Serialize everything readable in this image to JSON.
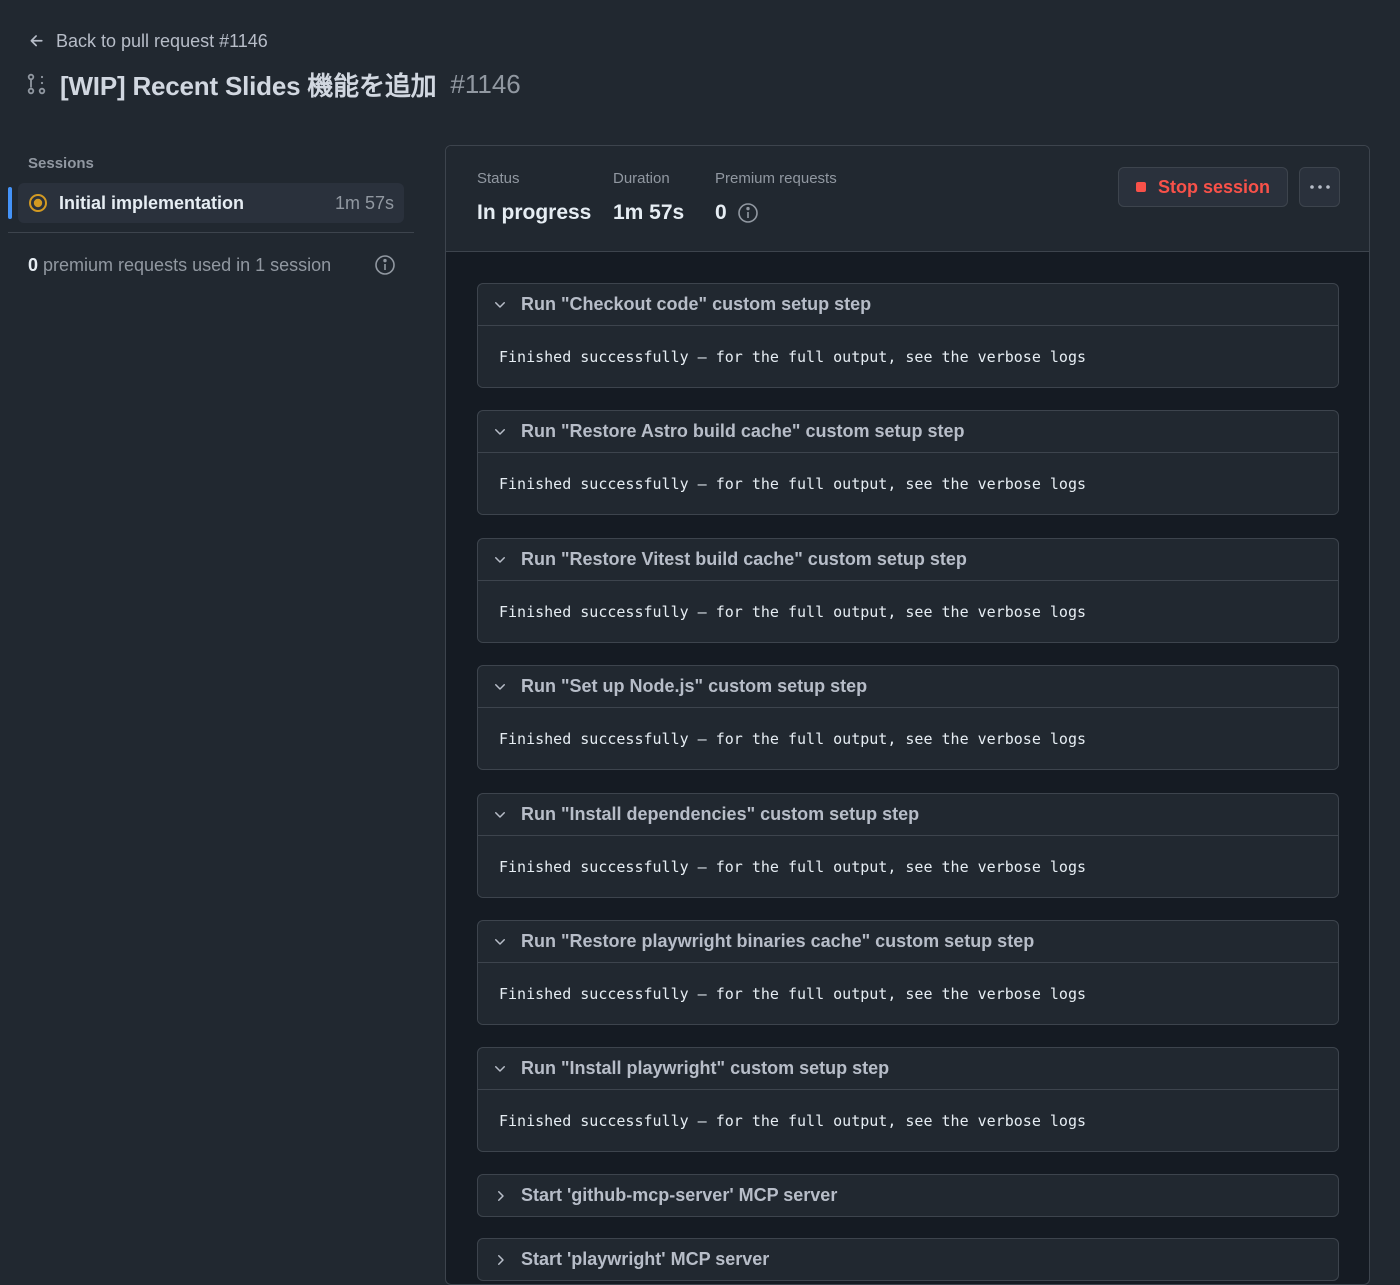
{
  "header": {
    "back_label": "Back to pull request #1146",
    "title": "[WIP] Recent Slides 機能を追加",
    "pr_number": "#1146"
  },
  "sidebar": {
    "heading": "Sessions",
    "sessions": [
      {
        "name": "Initial implementation",
        "duration": "1m 57s",
        "status": "in-progress"
      }
    ],
    "usage": {
      "count": "0",
      "text": "premium requests used in 1 session"
    }
  },
  "summary": {
    "status_label": "Status",
    "status_value": "In progress",
    "duration_label": "Duration",
    "duration_value": "1m 57s",
    "premium_label": "Premium requests",
    "premium_value": "0",
    "stop_label": "Stop session"
  },
  "steps": [
    {
      "title": "Run \"Checkout code\" custom setup step",
      "output": "Finished successfully – for the full output, see the verbose logs",
      "expanded": true
    },
    {
      "title": "Run \"Restore Astro build cache\" custom setup step",
      "output": "Finished successfully – for the full output, see the verbose logs",
      "expanded": true
    },
    {
      "title": "Run \"Restore Vitest build cache\" custom setup step",
      "output": "Finished successfully – for the full output, see the verbose logs",
      "expanded": true
    },
    {
      "title": "Run \"Set up Node.js\" custom setup step",
      "output": "Finished successfully – for the full output, see the verbose logs",
      "expanded": true
    },
    {
      "title": "Run \"Install dependencies\" custom setup step",
      "output": "Finished successfully – for the full output, see the verbose logs",
      "expanded": true
    },
    {
      "title": "Run \"Restore playwright binaries cache\" custom setup step",
      "output": "Finished successfully – for the full output, see the verbose logs",
      "expanded": true
    },
    {
      "title": "Run \"Install playwright\" custom setup step",
      "output": "Finished successfully – for the full output, see the verbose logs",
      "expanded": true
    },
    {
      "title": "Start 'github-mcp-server' MCP server",
      "expanded": false
    },
    {
      "title": "Start 'playwright' MCP server",
      "expanded": false
    }
  ],
  "colors": {
    "background": "#212830",
    "accent": "#4493f8",
    "danger": "#f85149",
    "in_progress": "#d29922"
  }
}
